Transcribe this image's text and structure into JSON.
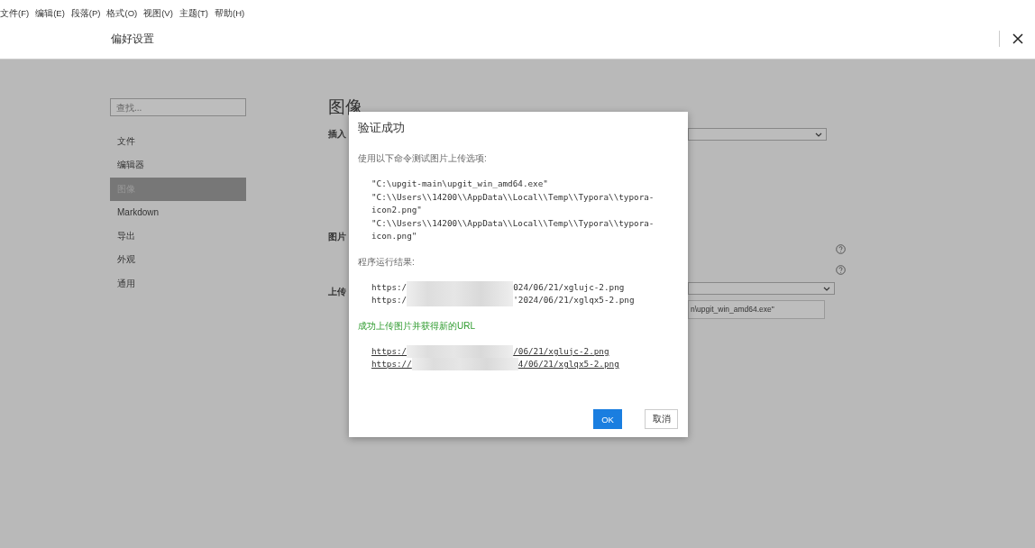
{
  "menu_bar": [
    "文件(F)",
    "编辑(E)",
    "段落(P)",
    "格式(O)",
    "视图(V)",
    "主题(T)",
    "帮助(H)"
  ],
  "header": {
    "title": "偏好设置"
  },
  "sidebar": {
    "search": {
      "placeholder": "查找..."
    },
    "items": [
      {
        "label": "文件",
        "selected": false
      },
      {
        "label": "编辑器",
        "selected": false
      },
      {
        "label": "图像",
        "selected": true
      },
      {
        "label": "Markdown",
        "selected": false
      },
      {
        "label": "导出",
        "selected": false
      },
      {
        "label": "外观",
        "selected": false
      },
      {
        "label": "通用",
        "selected": false
      }
    ]
  },
  "content": {
    "title": "图像",
    "sections": [
      {
        "label": "插入",
        "kind": "select"
      },
      {
        "label": "图片",
        "kind": "help"
      },
      {
        "label": "上传",
        "kind": "upload",
        "input_value": "n\\upgit_win_amd64.exe\""
      }
    ]
  },
  "dialog": {
    "title": "验证成功",
    "intro": "使用以下命令测试图片上传选项:",
    "command_lines": [
      "\"C:\\upgit-main\\upgit_win_amd64.exe\"",
      "\"C:\\\\Users\\\\14200\\\\AppData\\\\Local\\\\Temp\\\\Typora\\\\typora-",
      "icon2.png\"",
      "\"C:\\\\Users\\\\14200\\\\AppData\\\\Local\\\\Temp\\\\Typora\\\\typora-",
      "icon.png\""
    ],
    "result_label": "程序运行结果:",
    "result_urls": [
      {
        "start": "https:/",
        "end": "024/06/21/xglujc-2.png"
      },
      {
        "start": "https:/",
        "end": "'2024/06/21/xglqx5-2.png"
      }
    ],
    "success_message": "成功上传图片并获得新的URL",
    "uploaded_urls": [
      {
        "start": "https:/",
        "end": "/06/21/xglujc-2.png"
      },
      {
        "start": "https://",
        "end": "4/06/21/xglqx5-2.png"
      }
    ],
    "buttons": [
      {
        "label": "OK",
        "kind": "primary"
      },
      {
        "label": "取消",
        "kind": "secondary"
      }
    ]
  }
}
